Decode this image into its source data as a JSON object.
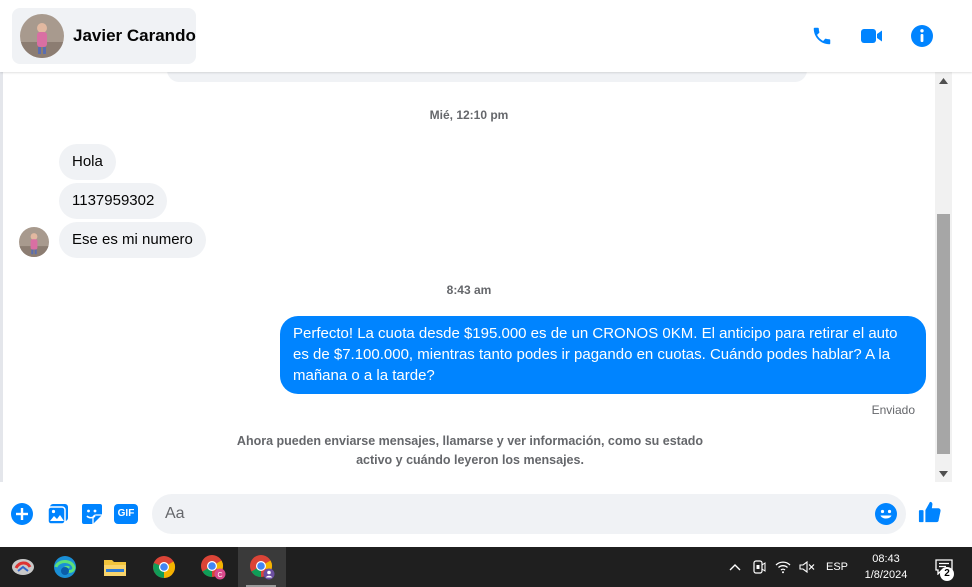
{
  "header": {
    "contact_name": "Javier Carando",
    "icons": [
      "phone-icon",
      "video-call-icon",
      "info-icon"
    ]
  },
  "thread": {
    "timestamp_1": "Mié, 12:10 pm",
    "incoming": [
      {
        "text": "Hola"
      },
      {
        "text": "1137959302"
      },
      {
        "text": "Ese es mi numero"
      }
    ],
    "timestamp_2": "8:43 am",
    "outgoing": {
      "text": "Perfecto! La cuota desde $195.000 es de un CRONOS 0KM. El anticipo para retirar el auto es de $7.100.000, mientras tanto podes ir pagando en cuotas. Cuándo podes hablar? A la mañana o a la tarde?"
    },
    "sent_status": "Enviado",
    "notice": "Ahora pueden enviarse mensajes, llamarse y ver información, como su estado activo y cuándo leyeron los mensajes."
  },
  "composer": {
    "placeholder": "Aa",
    "value": "",
    "gif_label": "GIF",
    "icons": [
      "plus-icon",
      "gallery-icon",
      "sticker-icon",
      "gif-icon",
      "emoji-icon",
      "like-icon"
    ]
  },
  "colors": {
    "accent": "#0084ff",
    "bubble_in": "#f0f2f5",
    "taskbar": "#1f1f1f"
  },
  "taskbar": {
    "language": "ESP",
    "time": "08:43",
    "date": "1/8/2024",
    "notifications_count": "2"
  }
}
